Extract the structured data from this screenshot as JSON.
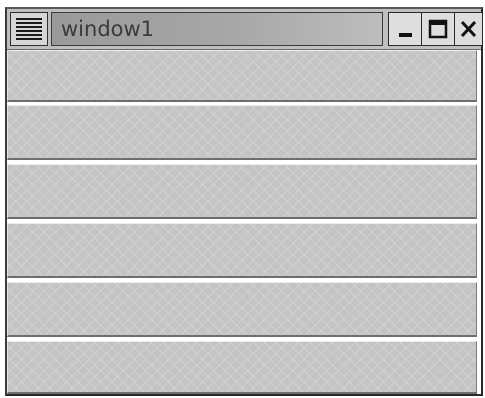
{
  "window": {
    "title": "window1",
    "rows": [
      "",
      "",
      "",
      "",
      "",
      ""
    ]
  },
  "icons": {
    "menu": "window-menu-icon",
    "minimize": "minimize-icon",
    "maximize": "maximize-icon",
    "close": "close-icon"
  },
  "colors": {
    "frame": "#2a2a2a",
    "title_gradient_start": "#9a9a9a",
    "title_gradient_end": "#bdbdbd",
    "row_fill": "#c4c4c4"
  }
}
